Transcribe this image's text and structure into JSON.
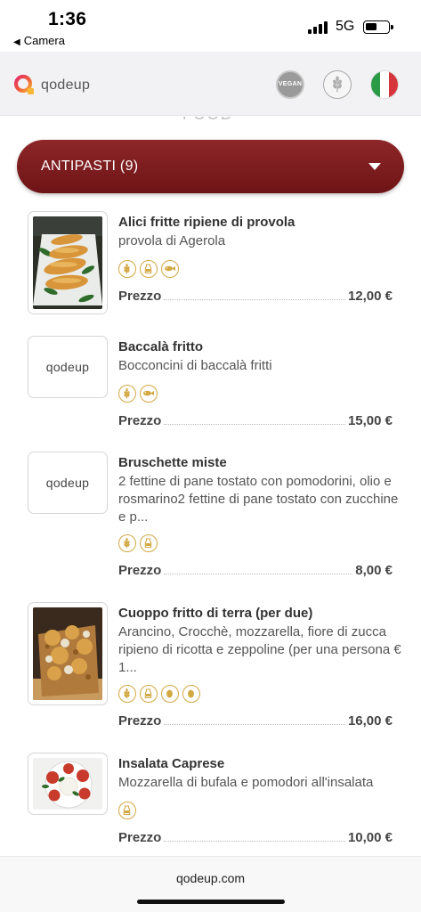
{
  "status_bar": {
    "time": "1:36",
    "back_label": "Camera",
    "network": "5G"
  },
  "header": {
    "logo_text": "qodeup",
    "vegan_badge_text": "VEGAN",
    "icons": [
      "vegan-icon",
      "gluten-free-icon",
      "italian-flag-icon"
    ]
  },
  "category": {
    "label": "ANTIPASTI (9)"
  },
  "price_label": "Prezzo",
  "items": [
    {
      "name": "Alici fritte ripiene di provola",
      "description": "provola di Agerola",
      "price": "12,00 €",
      "thumb": "photo",
      "allergens": [
        "wheat-icon",
        "milk-icon",
        "fish-icon"
      ]
    },
    {
      "name": "Baccalà fritto",
      "description": "Bocconcini di baccalà fritti",
      "price": "15,00 €",
      "thumb": "qodeup",
      "allergens": [
        "wheat-icon",
        "fish-icon"
      ]
    },
    {
      "name": "Bruschette miste",
      "description": "2 fettine di pane tostato con pomodorini, olio e rosmarino2 fettine di pane tostato con zucchine e p...",
      "price": "8,00 €",
      "thumb": "qodeup",
      "allergens": [
        "wheat-icon",
        "milk-icon"
      ]
    },
    {
      "name": "Cuoppo fritto di terra (per due)",
      "description": "Arancino, Crocchè, mozzarella, fiore di zucca ripieno di ricotta e zeppoline (per una persona € 1...",
      "price": "16,00 €",
      "thumb": "photo",
      "allergens": [
        "wheat-icon",
        "milk-icon",
        "egg-icon",
        "egg-icon"
      ]
    },
    {
      "name": "Insalata Caprese",
      "description": "Mozzarella di bufala e pomodori all'insalata",
      "price": "10,00 €",
      "thumb": "photo",
      "allergens": [
        "milk-icon"
      ]
    }
  ],
  "thumb_logo_text": "qodeup",
  "footer": {
    "url": "qodeup.com"
  },
  "colors": {
    "category_bar": "#7d1c1e",
    "allergen": "#d2a843",
    "header_bg": "#f2f2f4"
  }
}
